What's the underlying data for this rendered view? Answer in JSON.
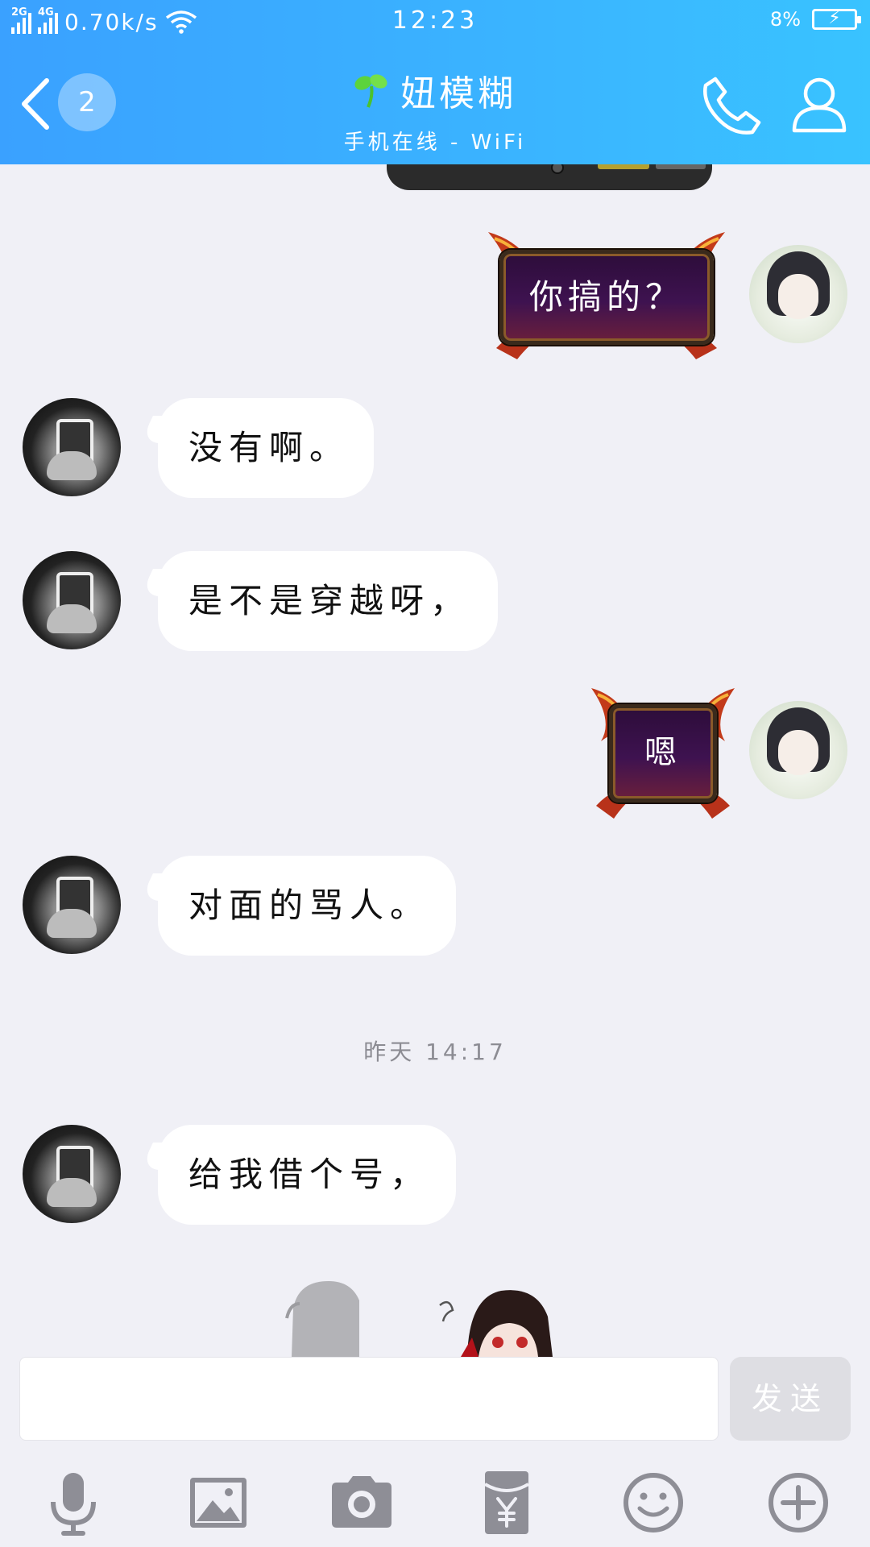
{
  "status_bar": {
    "network1": "2G",
    "network2": "4G",
    "speed": "0.70k/s",
    "time": "12:23",
    "battery": "8%"
  },
  "header": {
    "unread_count": "2",
    "contact_name": "妞模糊",
    "status": "手机在线 - WiFi"
  },
  "messages": [
    {
      "side": "self",
      "type": "sticker",
      "text": "你搞的？"
    },
    {
      "side": "other",
      "type": "text",
      "text": "没有啊。"
    },
    {
      "side": "other",
      "type": "text",
      "text": "是不是穿越呀，"
    },
    {
      "side": "self",
      "type": "sticker",
      "text": "嗯"
    },
    {
      "side": "other",
      "type": "text",
      "text": "对面的骂人。"
    },
    {
      "side": "other",
      "type": "text",
      "text": "给我借个号，"
    }
  ],
  "timestamp": "昨天 14:17",
  "input": {
    "placeholder": "",
    "send_label": "发送"
  },
  "toolbar": {
    "icons": [
      "microphone-icon",
      "image-icon",
      "camera-icon",
      "red-packet-icon",
      "emoji-icon",
      "plus-icon"
    ]
  },
  "colors": {
    "header_start": "#3aa1ff",
    "header_end": "#39c3ff",
    "chat_bg": "#f0f0f6",
    "bubble_bg": "#ffffff",
    "icon_gray": "#8e8e96"
  }
}
